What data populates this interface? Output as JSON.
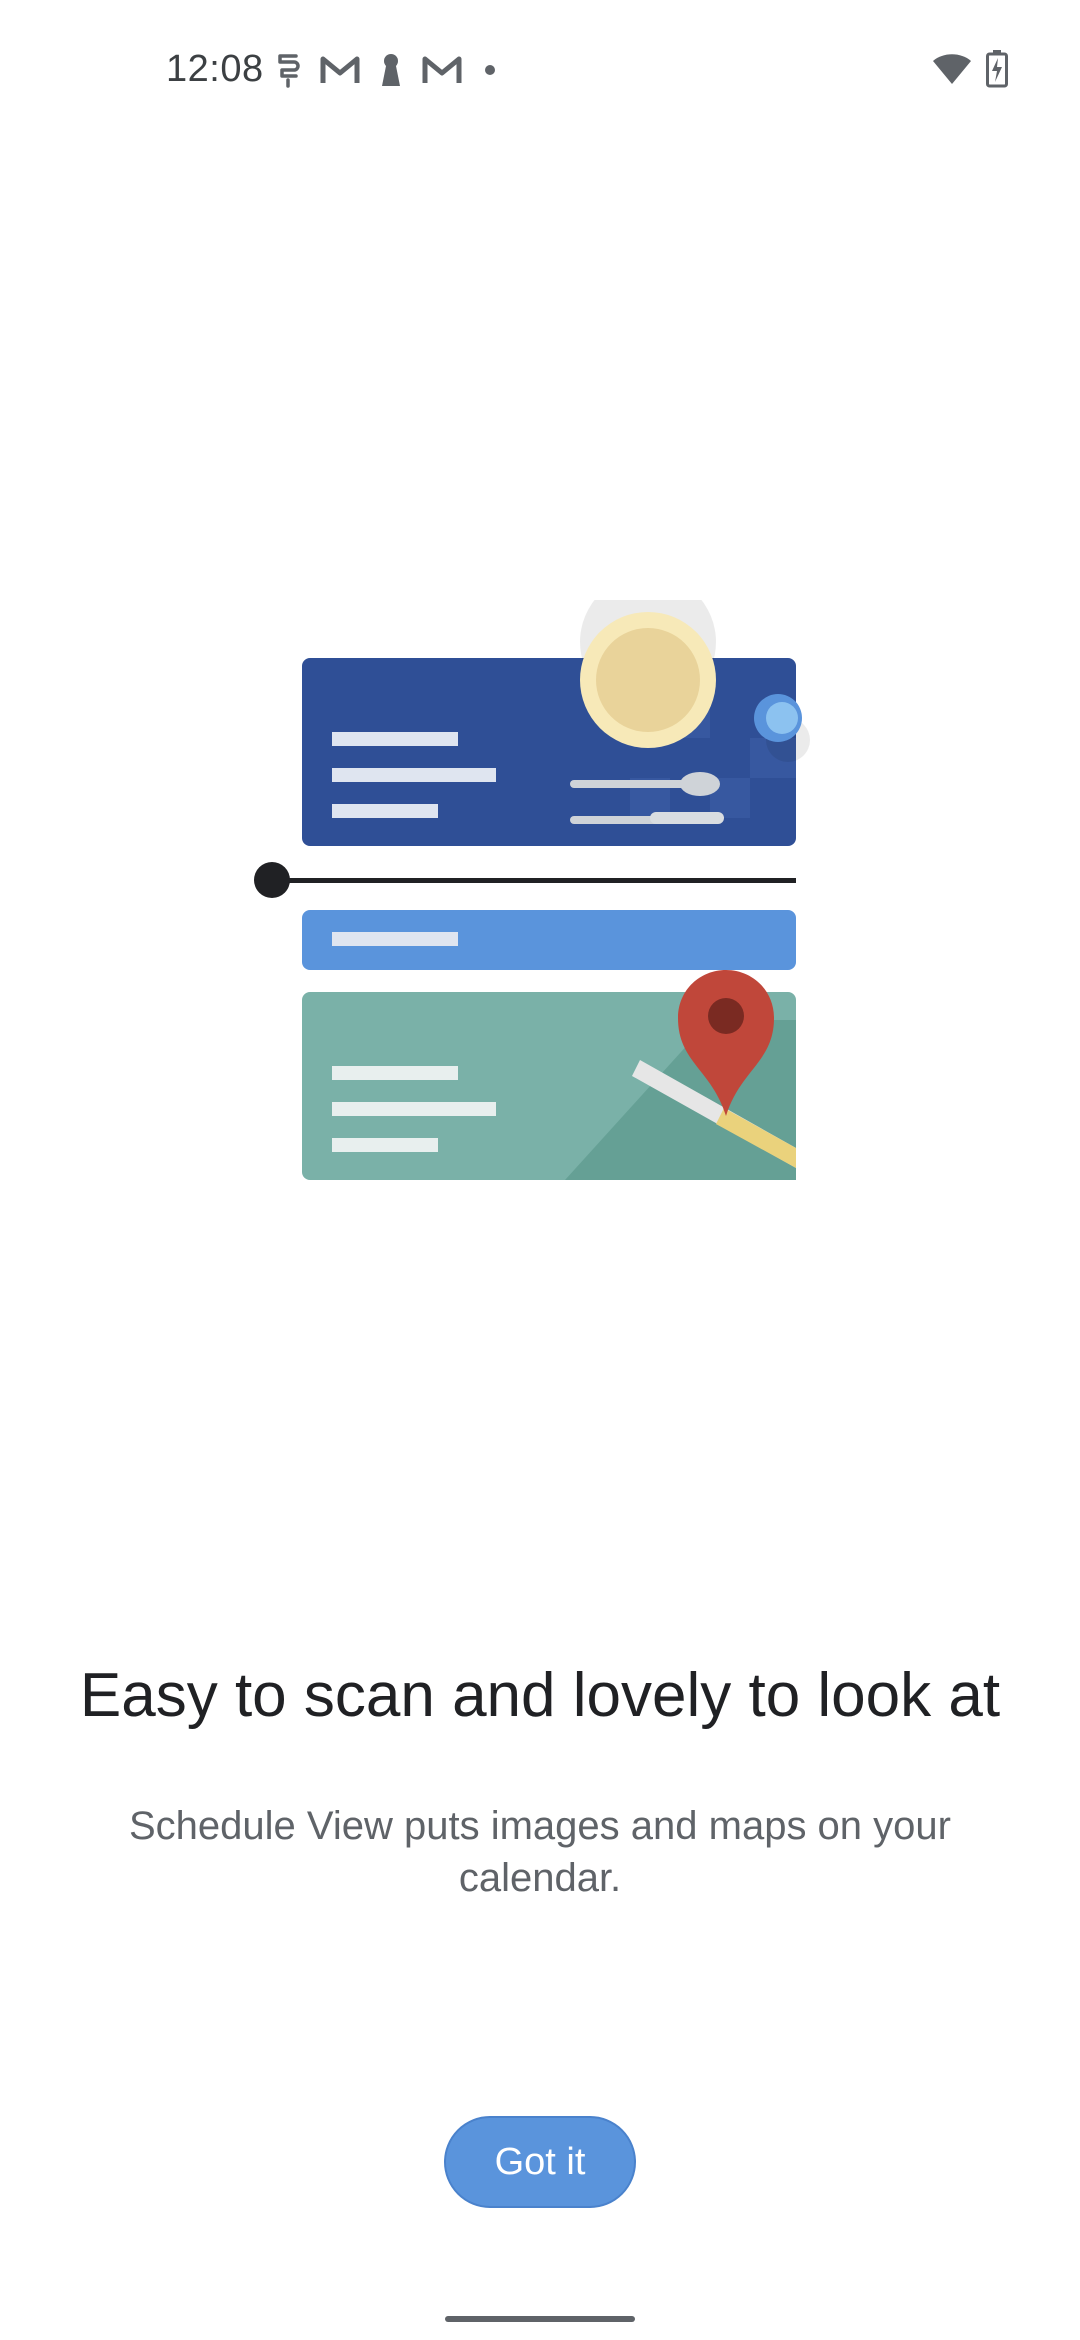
{
  "status_bar": {
    "time": "12:08",
    "left_icons": [
      "card-icon",
      "gmail-icon",
      "keyhole-icon",
      "gmail-icon",
      "dot-icon"
    ],
    "right_icons": [
      "wifi-icon",
      "battery-charging-icon"
    ]
  },
  "onboarding": {
    "headline": "Easy to scan and lovely to look at",
    "description": "Schedule View puts images and maps on your calendar.",
    "button_label": "Got it"
  },
  "colors": {
    "primary": "#5a94dc",
    "card_dark_blue": "#2f4f96",
    "card_light_blue": "#5a94dc",
    "card_teal": "#7ab1a8",
    "pin_red": "#c0473a"
  }
}
